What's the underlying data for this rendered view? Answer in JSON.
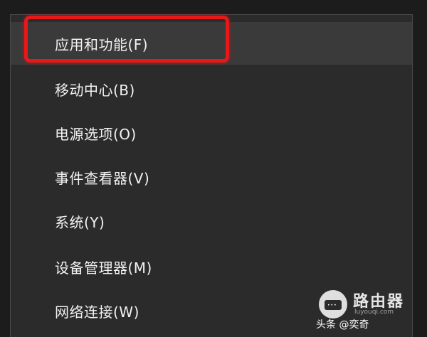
{
  "menu": {
    "items": [
      {
        "label": "应用和功能(F)"
      },
      {
        "label": "移动中心(B)"
      },
      {
        "label": "电源选项(O)"
      },
      {
        "label": "事件查看器(V)"
      },
      {
        "label": "系统(Y)"
      },
      {
        "label": "设备管理器(M)"
      },
      {
        "label": "网络连接(W)"
      }
    ],
    "highlighted_index": 0,
    "highlight_color": "#e81818"
  },
  "watermark": {
    "title": "路由器",
    "subtitle": "luyouqi.com",
    "author": "头条 @奕奇"
  }
}
